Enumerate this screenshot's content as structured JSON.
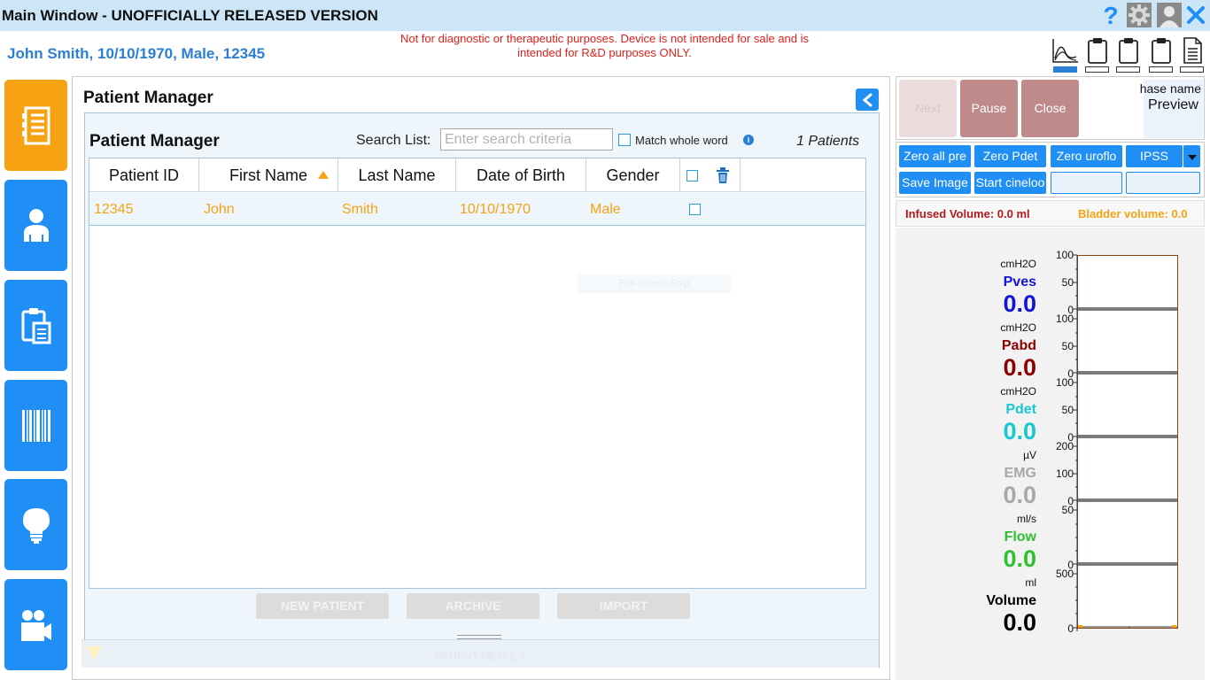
{
  "window": {
    "title": "Main Window - UNOFFICIALLY RELEASED VERSION"
  },
  "patient_header": "John Smith, 10/10/1970, Male, 12345",
  "disclaimer": "Not for diagnostic or therapeutic purposes. Device is not intended for sale and is intended for R&D purposes ONLY.",
  "nav": {
    "items": [
      {
        "icon": "list-document-icon",
        "active": true
      },
      {
        "icon": "person-icon",
        "active": false
      },
      {
        "icon": "clipboard-icon",
        "active": false
      },
      {
        "icon": "barcode-icon",
        "active": false
      },
      {
        "icon": "lightbulb-icon",
        "active": false
      },
      {
        "icon": "video-camera-icon",
        "active": false
      }
    ]
  },
  "patient_manager": {
    "heading": "Patient Manager",
    "subheading": "Patient Manager",
    "search_label": "Search List:",
    "search_placeholder": "Enter search criteria",
    "search_value": "",
    "match_whole_word": "Match whole word",
    "patient_count": "1 Patients",
    "columns": [
      "Patient ID",
      "First Name",
      "Last Name",
      "Date of Birth",
      "Gender"
    ],
    "rows": [
      {
        "id": "12345",
        "first": "John",
        "last": "Smith",
        "dob": "10/10/1970",
        "gender": "Male"
      }
    ],
    "ghost_text": "Full-screen Snip",
    "buttons": {
      "new_patient": "NEW PATIENT",
      "archive": "ARCHIVE",
      "import": "IMPORT"
    },
    "details_label": "PATIENT DETAILS"
  },
  "controls": {
    "next": "Next",
    "pause": "Pause",
    "close": "Close",
    "phase_name": "hase name",
    "phase_value": "Preview"
  },
  "tools": {
    "zero_all": "Zero all pre",
    "zero_pdet": "Zero Pdet",
    "zero_uroflow": "Zero uroflo",
    "ipss": "IPSS",
    "save_image": "Save Image",
    "start_cineloop": "Start cineloo"
  },
  "volumes": {
    "infused": "Infused Volume: 0.0 ml",
    "bladder": "Bladder volume: 0.0"
  },
  "channels": [
    {
      "unit": "cmH2O",
      "name": "Pves",
      "value": "0.0",
      "color": "#1414d6",
      "scale_top": "100",
      "scale_mid": "50",
      "scale_bottom": "0"
    },
    {
      "unit": "cmH2O",
      "name": "Pabd",
      "value": "0.0",
      "color": "#8b0000",
      "scale_top": "100",
      "scale_mid": "50",
      "scale_bottom": "0"
    },
    {
      "unit": "cmH2O",
      "name": "Pdet",
      "value": "0.0",
      "color": "#17c8d0",
      "scale_top": "100",
      "scale_mid": "50",
      "scale_bottom": "0"
    },
    {
      "unit": "µV",
      "name": "EMG",
      "value": "0.0",
      "color": "#a8a8a8",
      "scale_top": "200",
      "scale_mid": "100",
      "scale_bottom": "0"
    },
    {
      "unit": "ml/s",
      "name": "Flow",
      "value": "0.0",
      "color": "#2fc02f",
      "scale_top": "50",
      "scale_mid": "",
      "scale_bottom": "0"
    },
    {
      "unit": "ml",
      "name": "Volume",
      "value": "0.0",
      "color": "#000000",
      "scale_top": "500",
      "scale_mid": "",
      "scale_bottom": "0"
    }
  ],
  "colors": {
    "accent_blue": "#1f8ff5",
    "accent_orange": "#f7a212",
    "title_bar": "#cde6f7"
  }
}
